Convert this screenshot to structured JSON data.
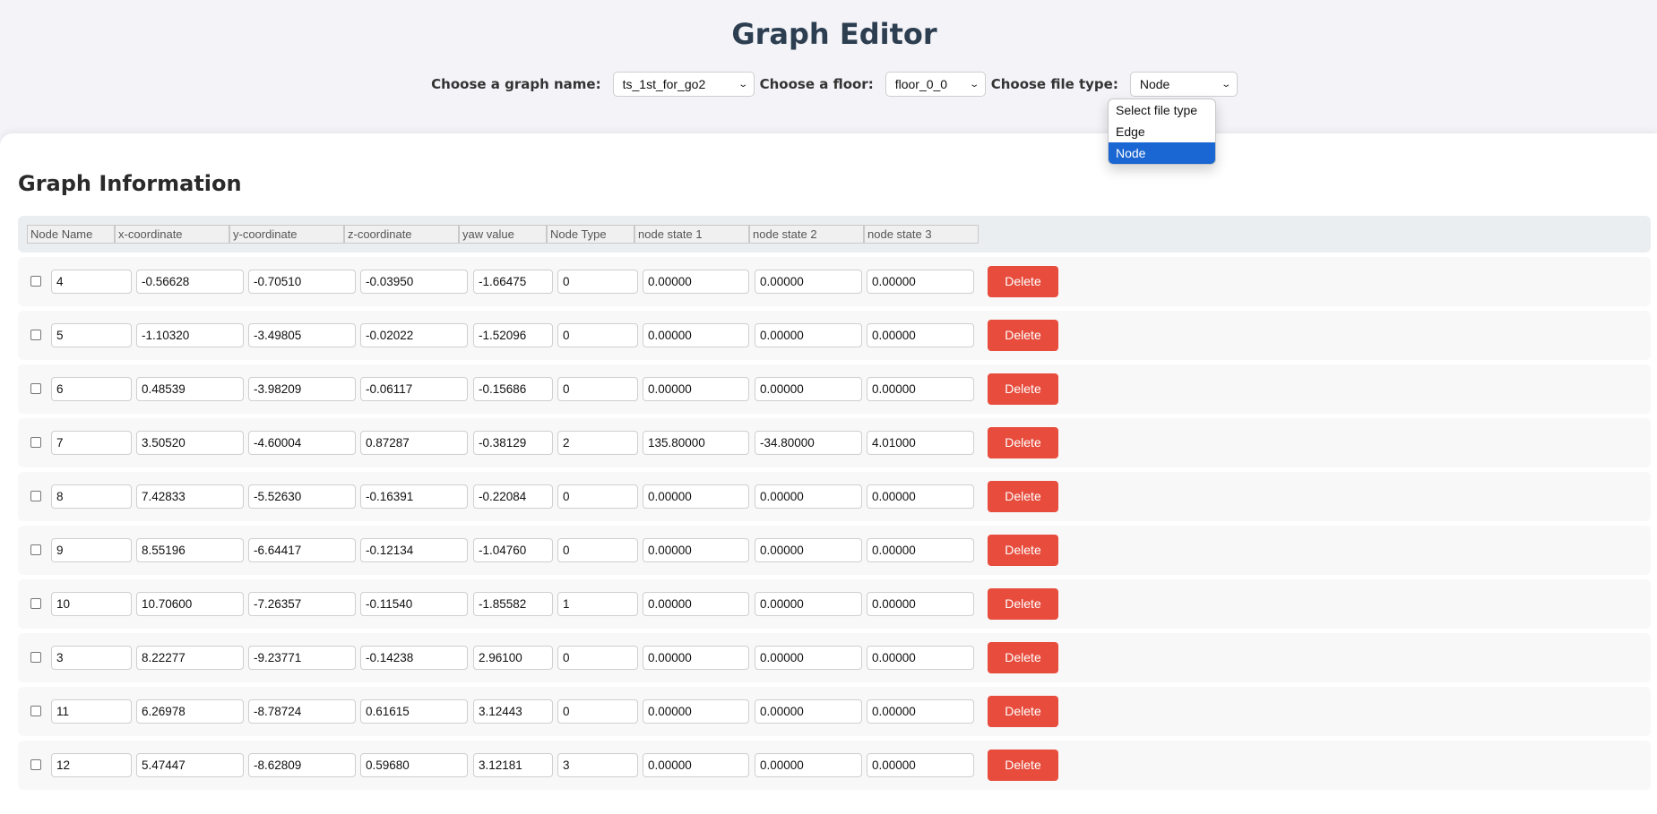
{
  "header": {
    "title": "Graph Editor",
    "graph_label": "Choose a graph name:",
    "graph_value": "ts_1st_for_go2",
    "floor_label": "Choose a floor:",
    "floor_value": "floor_0_0",
    "filetype_label": "Choose file type:",
    "filetype_value": "Node",
    "filetype_options": [
      "Select file type",
      "Edge",
      "Node"
    ],
    "filetype_selected_index": 2
  },
  "colors": {
    "delete_button": "#e74c3c",
    "dropdown_highlight": "#1a66d2",
    "title": "#2c3e50"
  },
  "section": {
    "title": "Graph Information",
    "columns": [
      "Node Name",
      "x-coordinate",
      "y-coordinate",
      "z-coordinate",
      "yaw value",
      "Node Type",
      "node state 1",
      "node state 2",
      "node state 3"
    ],
    "delete_label": "Delete",
    "rows": [
      {
        "checked": false,
        "name": "4",
        "x": "-0.56628",
        "y": "-0.70510",
        "z": "-0.03950",
        "yaw": "-1.66475",
        "type": "0",
        "s1": "0.00000",
        "s2": "0.00000",
        "s3": "0.00000"
      },
      {
        "checked": false,
        "name": "5",
        "x": "-1.10320",
        "y": "-3.49805",
        "z": "-0.02022",
        "yaw": "-1.52096",
        "type": "0",
        "s1": "0.00000",
        "s2": "0.00000",
        "s3": "0.00000"
      },
      {
        "checked": false,
        "name": "6",
        "x": "0.48539",
        "y": "-3.98209",
        "z": "-0.06117",
        "yaw": "-0.15686",
        "type": "0",
        "s1": "0.00000",
        "s2": "0.00000",
        "s3": "0.00000"
      },
      {
        "checked": false,
        "name": "7",
        "x": "3.50520",
        "y": "-4.60004",
        "z": "0.87287",
        "yaw": "-0.38129",
        "type": "2",
        "s1": "135.80000",
        "s2": "-34.80000",
        "s3": "4.01000"
      },
      {
        "checked": false,
        "name": "8",
        "x": "7.42833",
        "y": "-5.52630",
        "z": "-0.16391",
        "yaw": "-0.22084",
        "type": "0",
        "s1": "0.00000",
        "s2": "0.00000",
        "s3": "0.00000"
      },
      {
        "checked": false,
        "name": "9",
        "x": "8.55196",
        "y": "-6.64417",
        "z": "-0.12134",
        "yaw": "-1.04760",
        "type": "0",
        "s1": "0.00000",
        "s2": "0.00000",
        "s3": "0.00000"
      },
      {
        "checked": false,
        "name": "10",
        "x": "10.70600",
        "y": "-7.26357",
        "z": "-0.11540",
        "yaw": "-1.85582",
        "type": "1",
        "s1": "0.00000",
        "s2": "0.00000",
        "s3": "0.00000"
      },
      {
        "checked": false,
        "name": "3",
        "x": "8.22277",
        "y": "-9.23771",
        "z": "-0.14238",
        "yaw": "2.96100",
        "type": "0",
        "s1": "0.00000",
        "s2": "0.00000",
        "s3": "0.00000"
      },
      {
        "checked": false,
        "name": "11",
        "x": "6.26978",
        "y": "-8.78724",
        "z": "0.61615",
        "yaw": "3.12443",
        "type": "0",
        "s1": "0.00000",
        "s2": "0.00000",
        "s3": "0.00000"
      },
      {
        "checked": false,
        "name": "12",
        "x": "5.47447",
        "y": "-8.62809",
        "z": "0.59680",
        "yaw": "3.12181",
        "type": "3",
        "s1": "0.00000",
        "s2": "0.00000",
        "s3": "0.00000"
      }
    ]
  }
}
